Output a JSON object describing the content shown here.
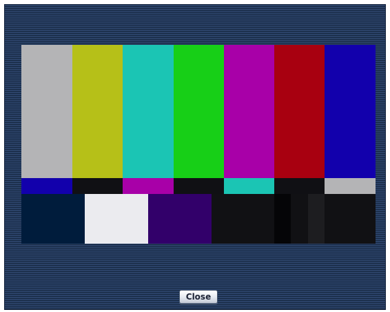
{
  "dialog": {
    "close_label": "Close"
  },
  "test_pattern": {
    "top_bars": [
      "#b4b4b6",
      "#b6c018",
      "#1bc5b4",
      "#17cf17",
      "#a800a8",
      "#a80010",
      "#1200ac"
    ],
    "middle_bars": [
      "#1200ac",
      "#101014",
      "#a800a8",
      "#101014",
      "#1bc5b4",
      "#101014",
      "#b4b4b6"
    ],
    "bottom_bars": [
      "#001c3c",
      "#ebebef",
      "#32006a",
      "#111114",
      "#050507",
      "#111114",
      "#1d1d20",
      "#111114"
    ]
  }
}
